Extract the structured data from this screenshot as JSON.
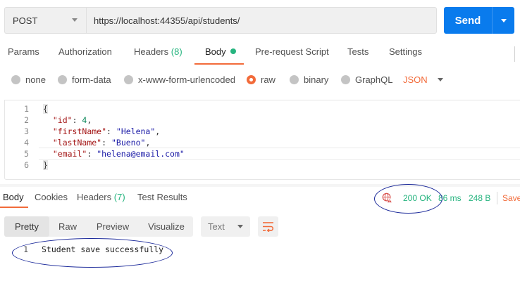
{
  "request": {
    "method": "POST",
    "url": "https://localhost:44355/api/students/",
    "send_label": "Send"
  },
  "request_tabs": {
    "params": "Params",
    "authorization": "Authorization",
    "headers": "Headers",
    "headers_count": "(8)",
    "body": "Body",
    "prerequest": "Pre-request Script",
    "tests": "Tests",
    "settings": "Settings"
  },
  "body_types": {
    "none": "none",
    "form_data": "form-data",
    "urlencoded": "x-www-form-urlencoded",
    "raw": "raw",
    "binary": "binary",
    "graphql": "GraphQL",
    "selected": "raw",
    "language": "JSON"
  },
  "editor": {
    "line_numbers": [
      "1",
      "2",
      "3",
      "4",
      "5",
      "6"
    ],
    "open_brace": "{",
    "close_brace": "}",
    "fields": [
      {
        "key": "\"id\"",
        "value": "4",
        "kind": "number",
        "comma": ","
      },
      {
        "key": "\"firstName\"",
        "value": "\"Helena\"",
        "kind": "string",
        "comma": ","
      },
      {
        "key": "\"lastName\"",
        "value": "\"Bueno\"",
        "kind": "string",
        "comma": ","
      },
      {
        "key": "\"email\"",
        "value": "\"helena@email.com\"",
        "kind": "string",
        "comma": ""
      }
    ]
  },
  "response_tabs": {
    "body": "Body",
    "cookies": "Cookies",
    "headers": "Headers",
    "headers_count": "(7)",
    "test_results": "Test Results"
  },
  "response_meta": {
    "status": "200 OK",
    "time": "86 ms",
    "size": "248 B",
    "save": "Save"
  },
  "response_toolbar": {
    "pretty": "Pretty",
    "raw": "Raw",
    "preview": "Preview",
    "visualize": "Visualize",
    "format": "Text"
  },
  "response_body": {
    "line_number": "1",
    "text": "Student save successfully"
  },
  "colors": {
    "accent": "#f26b3a",
    "send": "#097bed",
    "success": "#26b47f",
    "annotation": "#1c2a9a"
  }
}
